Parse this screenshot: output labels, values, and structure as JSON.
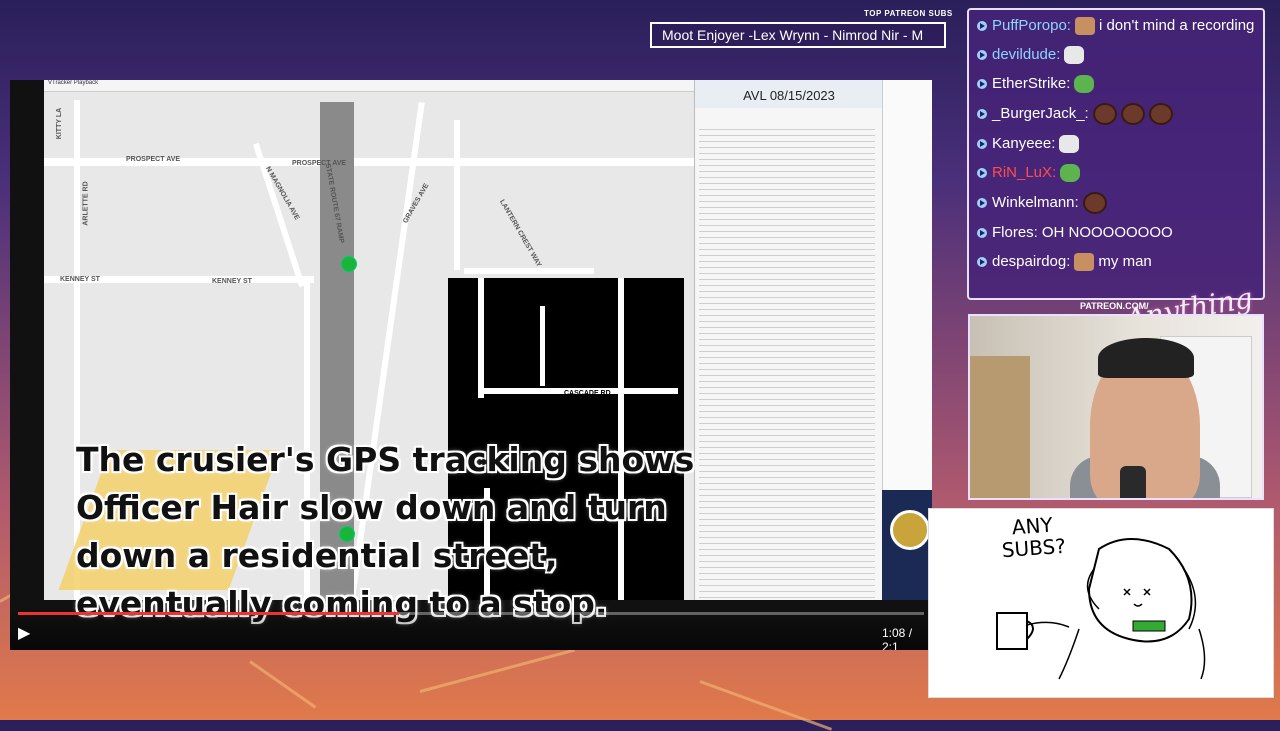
{
  "patreon": {
    "label": "TOP PATREON SUBS",
    "ticker": "Moot Enjoyer -Lex Wrynn - Nimrod Nir - M"
  },
  "video": {
    "app_title": "VTracker Playback",
    "avl_date": "AVL 08/15/2023",
    "caption": "The crusier's GPS tracking shows Officer Hair slow down and turn down a residential street, eventually coming to a stop.",
    "time": "1:08 / 2:1",
    "progress": 0.42,
    "streets": {
      "prospect": "PROSPECT AVE",
      "prospect2": "PROSPECT AVE",
      "kenney": "KENNEY ST",
      "kenney2": "KENNEY ST",
      "cascade": "CASCADE RD",
      "lantern": "LANTERN CREST WAY",
      "magnolia": "N MAGNOLIA AVE",
      "graves": "GRAVES AVE",
      "state_route": "STATE ROUTE 67 RAMP",
      "kitty": "KITTY LA",
      "arlette": "ARLETTE RD"
    }
  },
  "chat": {
    "messages": [
      {
        "user": "PuffPoropo:",
        "text": "i don't mind a recording",
        "color": "#8fd3ff",
        "emote": "face"
      },
      {
        "user": "devildude:",
        "text": "",
        "color": "#8fd3ff",
        "emote": "skull"
      },
      {
        "user": "EtherStrike:",
        "text": "",
        "color": "#ffffff",
        "emote": "green"
      },
      {
        "user": "_BurgerJack_:",
        "text": "",
        "color": "#ffffff",
        "emote": "brown3"
      },
      {
        "user": "Kanyeee:",
        "text": "",
        "color": "#ffffff",
        "emote": "skull"
      },
      {
        "user": "RiN_LuX:",
        "text": "",
        "color": "#ff4d4d",
        "emote": "green"
      },
      {
        "user": "Winkelmann:",
        "text": "",
        "color": "#ffffff",
        "emote": "brown"
      },
      {
        "user": "Flores:",
        "text": "OH NOOOOOOOO",
        "color": "#ffffff",
        "emote": ""
      },
      {
        "user": "despairdog:",
        "text": "my man",
        "color": "#ffffff",
        "emote": "face"
      }
    ]
  },
  "overlay": {
    "patreon_url": "PATREON.COM/",
    "logo": "Anything"
  },
  "drawing": {
    "line1": "ANY",
    "line2": "SUBS?"
  }
}
